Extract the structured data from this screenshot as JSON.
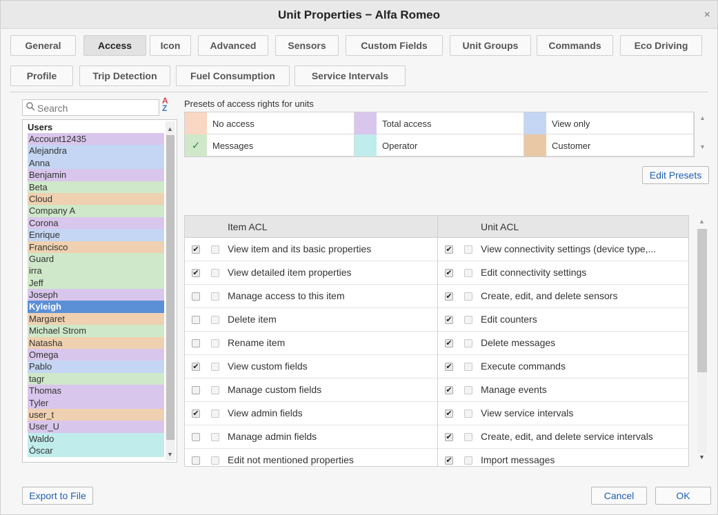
{
  "window": {
    "title": "Unit Properties − Alfa Romeo",
    "close_label": "×"
  },
  "tabs": [
    {
      "label": "General",
      "active": false
    },
    {
      "label": "Access",
      "active": true
    },
    {
      "label": "Icon",
      "active": false
    },
    {
      "label": "Advanced",
      "active": false
    },
    {
      "label": "Sensors",
      "active": false
    },
    {
      "label": "Custom Fields",
      "active": false
    },
    {
      "label": "Unit Groups",
      "active": false
    },
    {
      "label": "Commands",
      "active": false
    },
    {
      "label": "Eco Driving",
      "active": false
    },
    {
      "label": "Profile",
      "active": false
    },
    {
      "label": "Trip Detection",
      "active": false
    },
    {
      "label": "Fuel Consumption",
      "active": false
    },
    {
      "label": "Service Intervals",
      "active": false
    }
  ],
  "search": {
    "placeholder": "Search",
    "sort_top": "A",
    "sort_bottom": "Z"
  },
  "users": {
    "header": "Users",
    "selected": "Kyleigh",
    "items": [
      {
        "name": "Account12435",
        "color": "#d9c6ec"
      },
      {
        "name": "Alejandra",
        "color": "#c4d6f3"
      },
      {
        "name": "Anna",
        "color": "#c4d6f3"
      },
      {
        "name": "Benjamin",
        "color": "#d9c6ec"
      },
      {
        "name": "Beta",
        "color": "#cfe8c9"
      },
      {
        "name": "Cloud",
        "color": "#efd0b0"
      },
      {
        "name": "Company A",
        "color": "#cfe8c9"
      },
      {
        "name": "Corona",
        "color": "#d9c6ec"
      },
      {
        "name": "Enrique",
        "color": "#c4d6f3"
      },
      {
        "name": "Francisco",
        "color": "#efd0b0"
      },
      {
        "name": "Guard",
        "color": "#cfe8c9"
      },
      {
        "name": "irra",
        "color": "#cfe8c9"
      },
      {
        "name": "Jeff",
        "color": "#cfe8c9"
      },
      {
        "name": "Joseph",
        "color": "#d9c6ec"
      },
      {
        "name": "Kyleigh",
        "color": "#5b8fd6"
      },
      {
        "name": "Margaret",
        "color": "#efd0b0"
      },
      {
        "name": "Michael Strom",
        "color": "#cfe8c9"
      },
      {
        "name": "Natasha",
        "color": "#efd0b0"
      },
      {
        "name": "Omega",
        "color": "#d9c6ec"
      },
      {
        "name": "Pablo",
        "color": "#c4d6f3"
      },
      {
        "name": "tagr",
        "color": "#cfe8c9"
      },
      {
        "name": "Thomas",
        "color": "#d9c6ec"
      },
      {
        "name": "Tyler",
        "color": "#d9c6ec"
      },
      {
        "name": "user_t",
        "color": "#efd0b0"
      },
      {
        "name": "User_U",
        "color": "#d9c6ec"
      },
      {
        "name": "Waldo",
        "color": "#c0ecec"
      },
      {
        "name": "Óscar",
        "color": "#c0ecec"
      }
    ]
  },
  "presets": {
    "label": "Presets of access rights for units",
    "items": [
      {
        "label": "No access",
        "color": "#fad7c2",
        "checked": false
      },
      {
        "label": "Total access",
        "color": "#d9c6ec",
        "checked": false
      },
      {
        "label": "View only",
        "color": "#c4d6f3",
        "checked": false
      },
      {
        "label": "Messages",
        "color": "#cfe8c9",
        "checked": true
      },
      {
        "label": "Operator",
        "color": "#c0ecec",
        "checked": false
      },
      {
        "label": "Customer",
        "color": "#e9c8a5",
        "checked": false
      }
    ],
    "check_glyph": "✓"
  },
  "buttons": {
    "edit_presets": "Edit Presets",
    "export": "Export to File",
    "cancel": "Cancel",
    "ok": "OK"
  },
  "item_acl": {
    "header": "Item ACL",
    "rows": [
      {
        "label": "View item and its basic properties",
        "checked": true
      },
      {
        "label": "View detailed item properties",
        "checked": true
      },
      {
        "label": "Manage access to this item",
        "checked": false
      },
      {
        "label": "Delete item",
        "checked": false
      },
      {
        "label": "Rename item",
        "checked": false
      },
      {
        "label": "View custom fields",
        "checked": true
      },
      {
        "label": "Manage custom fields",
        "checked": false
      },
      {
        "label": "View admin fields",
        "checked": true
      },
      {
        "label": "Manage admin fields",
        "checked": false
      },
      {
        "label": "Edit not mentioned properties",
        "checked": false
      }
    ]
  },
  "unit_acl": {
    "header": "Unit ACL",
    "rows": [
      {
        "label": "View connectivity settings (device type,...",
        "checked": true
      },
      {
        "label": "Edit connectivity settings",
        "checked": true
      },
      {
        "label": "Create, edit, and delete sensors",
        "checked": true
      },
      {
        "label": "Edit counters",
        "checked": true
      },
      {
        "label": "Delete messages",
        "checked": true
      },
      {
        "label": "Execute commands",
        "checked": true
      },
      {
        "label": "Manage events",
        "checked": true
      },
      {
        "label": "View service intervals",
        "checked": true
      },
      {
        "label": "Create, edit, and delete service intervals",
        "checked": true
      },
      {
        "label": "Import messages",
        "checked": true
      }
    ]
  },
  "icons": {
    "search": "search-icon",
    "sort": "sort-az-icon",
    "close": "close-icon",
    "check": "checkmark-icon"
  }
}
